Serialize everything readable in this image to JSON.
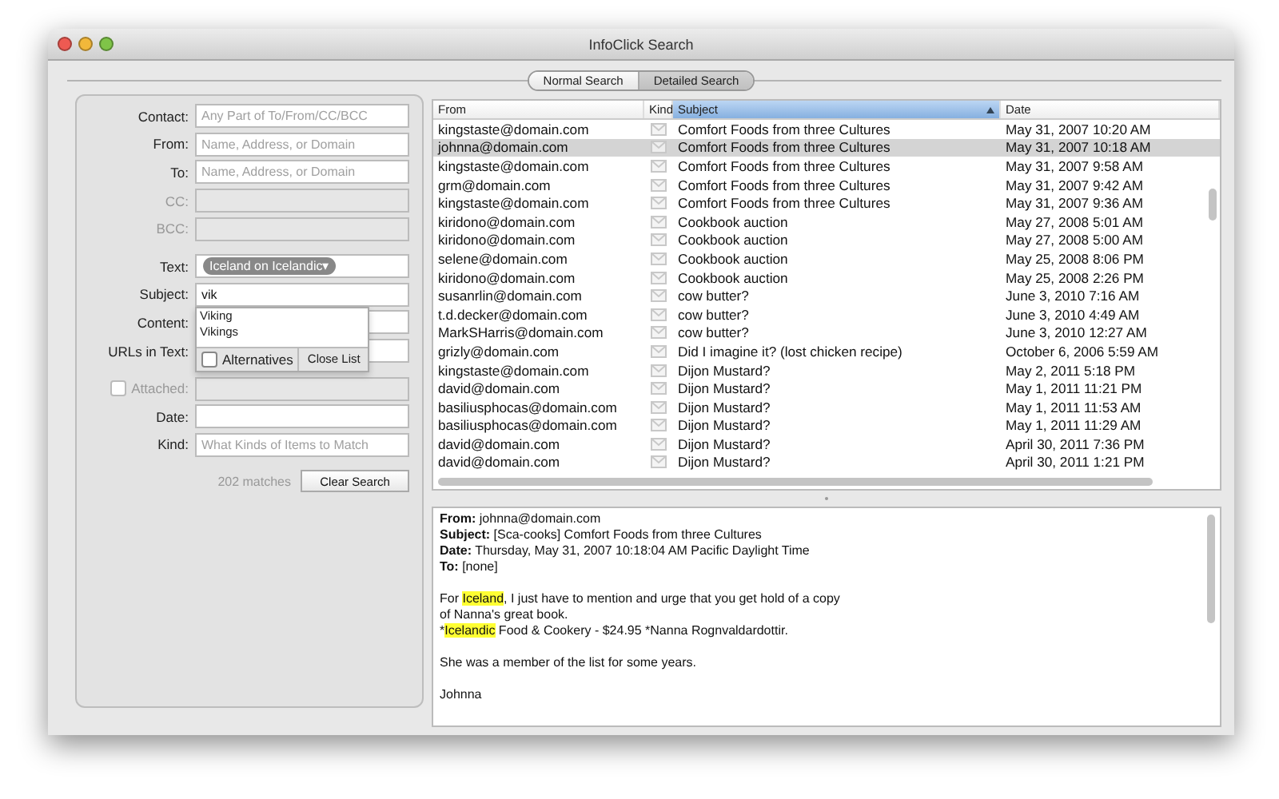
{
  "window": {
    "title": "InfoClick Search"
  },
  "modes": [
    {
      "label": "Normal Search",
      "selected": false
    },
    {
      "label": "Detailed Search",
      "selected": true
    }
  ],
  "search_form": {
    "fields": [
      {
        "kind": "field",
        "label": "Contact:",
        "placeholder": "Any Part of To/From/CC/BCC",
        "disabled": false
      },
      {
        "kind": "field",
        "label": "From:",
        "placeholder": "Name, Address, or Domain",
        "disabled": false
      },
      {
        "kind": "field",
        "label": "To:",
        "placeholder": "Name, Address, or Domain",
        "disabled": false
      },
      {
        "kind": "field",
        "label": "CC:",
        "disabled": true
      },
      {
        "kind": "field",
        "label": "BCC:",
        "disabled": true
      },
      {
        "kind": "token",
        "label": "Text:",
        "token": "Iceland on Icelandic▾"
      },
      {
        "kind": "field",
        "label": "Subject:",
        "value": "vik",
        "disabled": false
      },
      {
        "kind": "field",
        "label": "Content:",
        "disabled": false
      },
      {
        "kind": "field",
        "label": "URLs in Text:",
        "disabled": false
      },
      {
        "kind": "check",
        "label": "Attached:",
        "checked": false,
        "disabled": true
      },
      {
        "kind": "field",
        "label": "Date:",
        "disabled": false
      },
      {
        "kind": "field",
        "label": "Kind:",
        "placeholder": "What Kinds of Items to Match",
        "disabled": false
      }
    ],
    "suggestions": {
      "items": [
        "Viking",
        "Vikings"
      ],
      "alternatives": {
        "label": "Alternatives",
        "checked": false
      },
      "close_button": "Close List"
    },
    "match_count": "202 matches",
    "clear_button": "Clear Search"
  },
  "table": {
    "columns": [
      {
        "label": "From",
        "sorted": false
      },
      {
        "label": "Kind",
        "sorted": false
      },
      {
        "label": "Subject",
        "sorted": true
      },
      {
        "label": "Date",
        "sorted": false
      }
    ],
    "rows": [
      {
        "from": "kingstaste@domain.com",
        "subject": "Comfort Foods from three Cultures",
        "date": "May 31, 2007 10:20 AM",
        "selected": false
      },
      {
        "from": "johnna@domain.com",
        "subject": "Comfort Foods from three Cultures",
        "date": "May 31, 2007 10:18 AM",
        "selected": true
      },
      {
        "from": "kingstaste@domain.com",
        "subject": "Comfort Foods from three Cultures",
        "date": "May 31, 2007 9:58 AM",
        "selected": false
      },
      {
        "from": "grm@domain.com",
        "subject": "Comfort Foods from three Cultures",
        "date": "May 31, 2007 9:42 AM",
        "selected": false
      },
      {
        "from": "kingstaste@domain.com",
        "subject": "Comfort Foods from three Cultures",
        "date": "May 31, 2007 9:36 AM",
        "selected": false
      },
      {
        "from": "kiridono@domain.com",
        "subject": "Cookbook auction",
        "date": "May 27, 2008 5:01 AM",
        "selected": false
      },
      {
        "from": "kiridono@domain.com",
        "subject": "Cookbook auction",
        "date": "May 27, 2008 5:00 AM",
        "selected": false
      },
      {
        "from": "selene@domain.com",
        "subject": "Cookbook auction",
        "date": "May 25, 2008 8:06 PM",
        "selected": false
      },
      {
        "from": "kiridono@domain.com",
        "subject": "Cookbook auction",
        "date": "May 25, 2008 2:26 PM",
        "selected": false
      },
      {
        "from": "susanrlin@domain.com",
        "subject": "cow butter?",
        "date": "June 3, 2010 7:16 AM",
        "selected": false
      },
      {
        "from": "t.d.decker@domain.com",
        "subject": "cow butter?",
        "date": "June 3, 2010 4:49 AM",
        "selected": false
      },
      {
        "from": "MarkSHarris@domain.com",
        "subject": "cow butter?",
        "date": "June 3, 2010 12:27 AM",
        "selected": false
      },
      {
        "from": "grizly@domain.com",
        "subject": "Did I imagine it? (lost chicken recipe)",
        "date": "October 6, 2006 5:59 AM",
        "selected": false
      },
      {
        "from": "kingstaste@domain.com",
        "subject": "Dijon Mustard?",
        "date": "May 2, 2011 5:18 PM",
        "selected": false
      },
      {
        "from": "david@domain.com",
        "subject": "Dijon Mustard?",
        "date": "May 1, 2011 11:21 PM",
        "selected": false
      },
      {
        "from": "basiliusphocas@domain.com",
        "subject": "Dijon Mustard?",
        "date": "May 1, 2011 11:53 AM",
        "selected": false
      },
      {
        "from": "basiliusphocas@domain.com",
        "subject": "Dijon Mustard?",
        "date": "May 1, 2011 11:29 AM",
        "selected": false
      },
      {
        "from": "david@domain.com",
        "subject": "Dijon Mustard?",
        "date": "April 30, 2011 7:36 PM",
        "selected": false
      },
      {
        "from": "david@domain.com",
        "subject": "Dijon Mustard?",
        "date": "April 30, 2011 1:21 PM",
        "selected": false
      }
    ]
  },
  "preview": {
    "headers": [
      "**From:** johnna@domain.com",
      "**Subject:** [Sca-cooks] Comfort Foods from three Cultures",
      "**Date:** Thursday, May 31, 2007 10:18:04 AM Pacific Daylight Time",
      "**To:** [none]"
    ],
    "paragraphs": [
      {
        "lines": [
          [
            {
              "text": "For ",
              "highlight": false
            },
            {
              "text": "Iceland",
              "highlight": true
            },
            {
              "text": ", I just have to mention and urge that you get hold of a copy",
              "highlight": false
            }
          ],
          [
            {
              "text": "of Nanna's great book.",
              "highlight": false
            }
          ],
          [
            {
              "text": "*",
              "highlight": false
            },
            {
              "text": "Icelandic",
              "highlight": true
            },
            {
              "text": " Food & Cookery - $24.95  *Nanna Rognvaldardottir.",
              "highlight": false
            }
          ]
        ]
      },
      {
        "lines": [
          [
            {
              "text": "She was a member of the list for some years.",
              "highlight": false
            }
          ]
        ]
      },
      {
        "lines": [
          [
            {
              "text": "Johnna",
              "highlight": false
            }
          ]
        ]
      }
    ]
  }
}
